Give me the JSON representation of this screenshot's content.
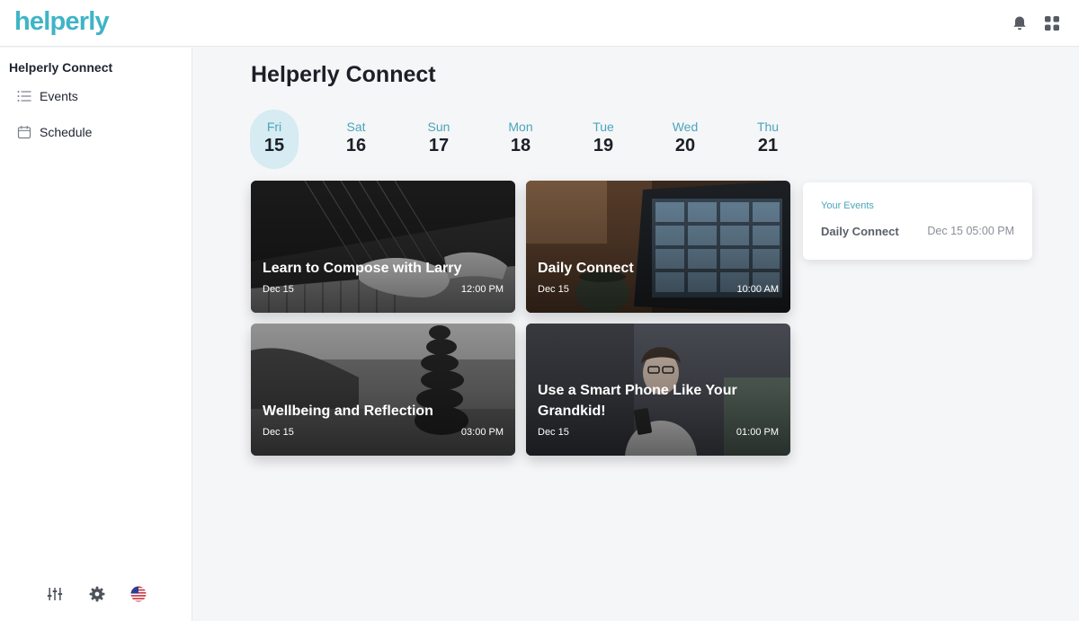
{
  "app": {
    "logo_text": "helperly",
    "brand_color": "#3fb4c7",
    "accent_color": "#4aa5b9",
    "header_icons": [
      "bell-icon",
      "apps-grid-icon"
    ]
  },
  "sidebar": {
    "title": "Helperly Connect",
    "items": [
      {
        "label": "Events",
        "icon": "list-icon"
      },
      {
        "label": "Schedule",
        "icon": "calendar-icon"
      }
    ],
    "bottom_icons": [
      "sliders-icon",
      "gear-icon",
      "us-flag-icon"
    ]
  },
  "main": {
    "title": "Helperly Connect",
    "days": [
      {
        "name": "Fri",
        "date": "15",
        "selected": true
      },
      {
        "name": "Sat",
        "date": "16",
        "selected": false
      },
      {
        "name": "Sun",
        "date": "17",
        "selected": false
      },
      {
        "name": "Mon",
        "date": "18",
        "selected": false
      },
      {
        "name": "Tue",
        "date": "19",
        "selected": false
      },
      {
        "name": "Wed",
        "date": "20",
        "selected": false
      },
      {
        "name": "Thu",
        "date": "21",
        "selected": false
      }
    ],
    "events": [
      {
        "title": "Learn to Compose with Larry",
        "date": "Dec 15",
        "time": "12:00 PM"
      },
      {
        "title": "Daily Connect",
        "date": "Dec 15",
        "time": "10:00 AM"
      },
      {
        "title": "Wellbeing and Reflection",
        "date": "Dec 15",
        "time": "03:00 PM"
      },
      {
        "title": "Use a Smart Phone Like Your Grandkid!",
        "date": "Dec 15",
        "time": "01:00 PM"
      }
    ]
  },
  "your_events": {
    "title": "Your Events",
    "items": [
      {
        "name": "Daily Connect",
        "when": "Dec 15 05:00 PM"
      }
    ]
  }
}
